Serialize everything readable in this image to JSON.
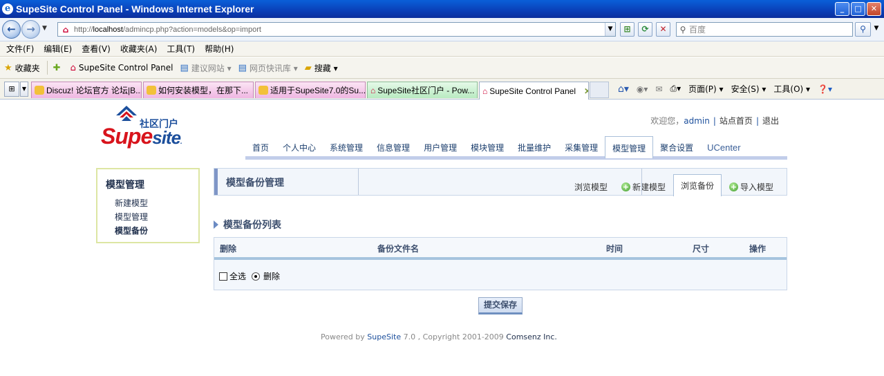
{
  "window": {
    "title": "SupeSite Control Panel - Windows Internet Explorer",
    "buttons": {
      "minimize": "_",
      "maximize": "□",
      "close": "✕"
    }
  },
  "address": {
    "url_prefix": "http://",
    "url_host": "localhost",
    "url_path": "/admincp.php?action=models&op=import",
    "search_placeholder": "百度"
  },
  "menu": [
    "文件(F)",
    "编辑(E)",
    "查看(V)",
    "收藏夹(A)",
    "工具(T)",
    "帮助(H)"
  ],
  "favorites": {
    "label": "收藏夹",
    "items": [
      "SupeSite Control Panel",
      "建议网站 ▾",
      "网页快讯库 ▾",
      "搜藏 ▾"
    ]
  },
  "tabs": [
    "Discuz! 论坛官方 论坛|B...",
    "如何安装模型，在那下...",
    "适用于SupeSite7.0的Su...",
    "SupeSite社区门户 - Pow...",
    "SupeSite Control Panel"
  ],
  "commands": [
    "页面(P) ▾",
    "安全(S) ▾",
    "工具(O) ▾"
  ],
  "site": {
    "logo_cn": "社区门户",
    "logo_word_a": "Supe",
    "logo_word_b": "site",
    "welcome": "欢迎您，",
    "username": "admin",
    "home_link": "站点首页",
    "logout_link": "退出"
  },
  "main_nav": [
    "首页",
    "个人中心",
    "系统管理",
    "信息管理",
    "用户管理",
    "模块管理",
    "批量维护",
    "采集管理",
    "模型管理",
    "聚合设置",
    "UCenter"
  ],
  "sidebar": {
    "title": "模型管理",
    "items": [
      "新建模型",
      "模型管理",
      "模型备份"
    ]
  },
  "panel": {
    "title": "模型备份管理",
    "subtabs": [
      "浏览模型",
      "新建模型",
      "浏览备份",
      "导入模型"
    ]
  },
  "list": {
    "title": "模型备份列表",
    "columns": [
      "删除",
      "备份文件名",
      "时间",
      "尺寸",
      "操作"
    ],
    "select_all": "全选",
    "delete_label": "删除",
    "submit_label": "提交保存"
  },
  "footer": {
    "powered": "Powered by ",
    "product": "SupeSite",
    "version": " 7.0 , Copyright 2001-2009 ",
    "company": "Comsenz Inc."
  }
}
